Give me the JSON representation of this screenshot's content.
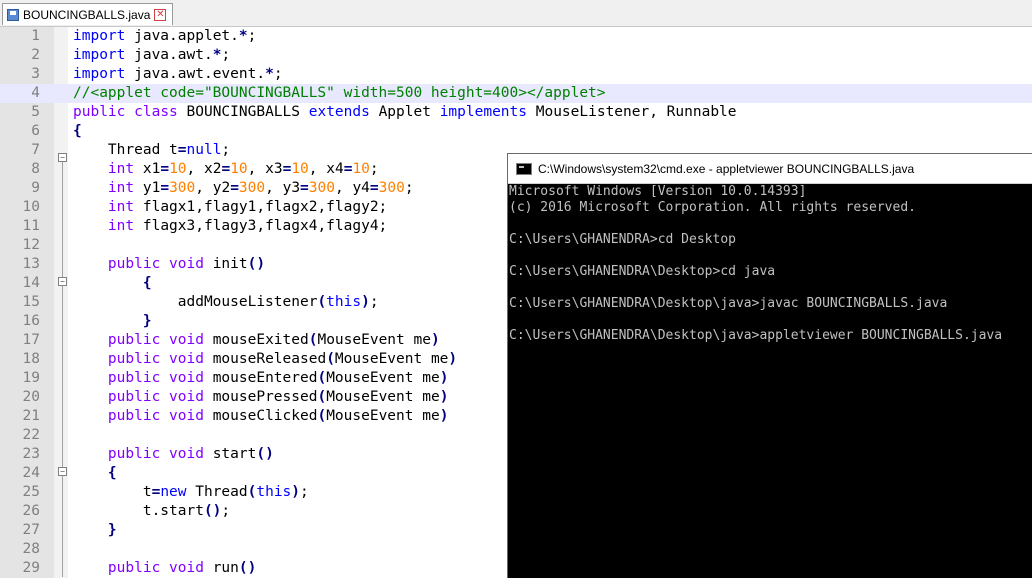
{
  "tab": {
    "label": "BOUNCINGBALLS.java"
  },
  "editor": {
    "highlighted_line": 4,
    "lines": [
      {
        "n": "1"
      },
      {
        "n": "2"
      },
      {
        "n": "3"
      },
      {
        "n": "4"
      },
      {
        "n": "5"
      },
      {
        "n": "6"
      },
      {
        "n": "7"
      },
      {
        "n": "8"
      },
      {
        "n": "9"
      },
      {
        "n": "10"
      },
      {
        "n": "11"
      },
      {
        "n": "12"
      },
      {
        "n": "13"
      },
      {
        "n": "14"
      },
      {
        "n": "15"
      },
      {
        "n": "16"
      },
      {
        "n": "17"
      },
      {
        "n": "18"
      },
      {
        "n": "19"
      },
      {
        "n": "20"
      },
      {
        "n": "21"
      },
      {
        "n": "22"
      },
      {
        "n": "23"
      },
      {
        "n": "24"
      },
      {
        "n": "25"
      },
      {
        "n": "26"
      },
      {
        "n": "27"
      },
      {
        "n": "28"
      },
      {
        "n": "29"
      }
    ],
    "code": [
      [
        [
          "kb",
          "import"
        ],
        [
          "pl",
          " java.applet."
        ],
        [
          "op",
          "*"
        ],
        [
          "pl",
          ";"
        ]
      ],
      [
        [
          "kb",
          "import"
        ],
        [
          "pl",
          " java.awt."
        ],
        [
          "op",
          "*"
        ],
        [
          "pl",
          ";"
        ]
      ],
      [
        [
          "kb",
          "import"
        ],
        [
          "pl",
          " java.awt.event."
        ],
        [
          "op",
          "*"
        ],
        [
          "pl",
          ";"
        ]
      ],
      [
        [
          "cm",
          "//<applet code=\"BOUNCINGBALLS\" width=500 height=400></applet>"
        ]
      ],
      [
        [
          "kw",
          "public"
        ],
        [
          "pl",
          " "
        ],
        [
          "kw",
          "class"
        ],
        [
          "pl",
          " BOUNCINGBALLS "
        ],
        [
          "kb",
          "extends"
        ],
        [
          "pl",
          " Applet "
        ],
        [
          "kb",
          "implements"
        ],
        [
          "pl",
          " MouseListener, Runnable"
        ]
      ],
      [
        [
          "op",
          "{"
        ]
      ],
      [
        [
          "pl",
          "    Thread t"
        ],
        [
          "op",
          "="
        ],
        [
          "kb",
          "null"
        ],
        [
          "pl",
          ";"
        ]
      ],
      [
        [
          "pl",
          "    "
        ],
        [
          "kw",
          "int"
        ],
        [
          "pl",
          " x1"
        ],
        [
          "op",
          "="
        ],
        [
          "num",
          "10"
        ],
        [
          "pl",
          ", x2"
        ],
        [
          "op",
          "="
        ],
        [
          "num",
          "10"
        ],
        [
          "pl",
          ", x3"
        ],
        [
          "op",
          "="
        ],
        [
          "num",
          "10"
        ],
        [
          "pl",
          ", x4"
        ],
        [
          "op",
          "="
        ],
        [
          "num",
          "10"
        ],
        [
          "pl",
          ";"
        ]
      ],
      [
        [
          "pl",
          "    "
        ],
        [
          "kw",
          "int"
        ],
        [
          "pl",
          " y1"
        ],
        [
          "op",
          "="
        ],
        [
          "num",
          "300"
        ],
        [
          "pl",
          ", y2"
        ],
        [
          "op",
          "="
        ],
        [
          "num",
          "300"
        ],
        [
          "pl",
          ", y3"
        ],
        [
          "op",
          "="
        ],
        [
          "num",
          "300"
        ],
        [
          "pl",
          ", y4"
        ],
        [
          "op",
          "="
        ],
        [
          "num",
          "300"
        ],
        [
          "pl",
          ";"
        ]
      ],
      [
        [
          "pl",
          "    "
        ],
        [
          "kw",
          "int"
        ],
        [
          "pl",
          " flagx1,flagy1,flagx2,flagy2;"
        ]
      ],
      [
        [
          "pl",
          "    "
        ],
        [
          "kw",
          "int"
        ],
        [
          "pl",
          " flagx3,flagy3,flagx4,flagy4;"
        ]
      ],
      [],
      [
        [
          "pl",
          "    "
        ],
        [
          "kw",
          "public"
        ],
        [
          "pl",
          " "
        ],
        [
          "kw",
          "void"
        ],
        [
          "pl",
          " init"
        ],
        [
          "op",
          "()"
        ]
      ],
      [
        [
          "pl",
          "        "
        ],
        [
          "op",
          "{"
        ]
      ],
      [
        [
          "pl",
          "            addMouseListener"
        ],
        [
          "op",
          "("
        ],
        [
          "kb",
          "this"
        ],
        [
          "op",
          ")"
        ],
        [
          "pl",
          ";"
        ]
      ],
      [
        [
          "pl",
          "        "
        ],
        [
          "op",
          "}"
        ]
      ],
      [
        [
          "pl",
          "    "
        ],
        [
          "kw",
          "public"
        ],
        [
          "pl",
          " "
        ],
        [
          "kw",
          "void"
        ],
        [
          "pl",
          " mouseExited"
        ],
        [
          "op",
          "("
        ],
        [
          "pl",
          "MouseEvent me"
        ],
        [
          "op",
          ")"
        ]
      ],
      [
        [
          "pl",
          "    "
        ],
        [
          "kw",
          "public"
        ],
        [
          "pl",
          " "
        ],
        [
          "kw",
          "void"
        ],
        [
          "pl",
          " mouseReleased"
        ],
        [
          "op",
          "("
        ],
        [
          "pl",
          "MouseEvent me"
        ],
        [
          "op",
          ")"
        ]
      ],
      [
        [
          "pl",
          "    "
        ],
        [
          "kw",
          "public"
        ],
        [
          "pl",
          " "
        ],
        [
          "kw",
          "void"
        ],
        [
          "pl",
          " mouseEntered"
        ],
        [
          "op",
          "("
        ],
        [
          "pl",
          "MouseEvent me"
        ],
        [
          "op",
          ")"
        ]
      ],
      [
        [
          "pl",
          "    "
        ],
        [
          "kw",
          "public"
        ],
        [
          "pl",
          " "
        ],
        [
          "kw",
          "void"
        ],
        [
          "pl",
          " mousePressed"
        ],
        [
          "op",
          "("
        ],
        [
          "pl",
          "MouseEvent me"
        ],
        [
          "op",
          ")"
        ]
      ],
      [
        [
          "pl",
          "    "
        ],
        [
          "kw",
          "public"
        ],
        [
          "pl",
          " "
        ],
        [
          "kw",
          "void"
        ],
        [
          "pl",
          " mouseClicked"
        ],
        [
          "op",
          "("
        ],
        [
          "pl",
          "MouseEvent me"
        ],
        [
          "op",
          ")"
        ]
      ],
      [],
      [
        [
          "pl",
          "    "
        ],
        [
          "kw",
          "public"
        ],
        [
          "pl",
          " "
        ],
        [
          "kw",
          "void"
        ],
        [
          "pl",
          " start"
        ],
        [
          "op",
          "()"
        ]
      ],
      [
        [
          "pl",
          "    "
        ],
        [
          "op",
          "{"
        ]
      ],
      [
        [
          "pl",
          "        t"
        ],
        [
          "op",
          "="
        ],
        [
          "kb",
          "new"
        ],
        [
          "pl",
          " Thread"
        ],
        [
          "op",
          "("
        ],
        [
          "kb",
          "this"
        ],
        [
          "op",
          ")"
        ],
        [
          "pl",
          ";"
        ]
      ],
      [
        [
          "pl",
          "        t.start"
        ],
        [
          "op",
          "()"
        ],
        [
          "pl",
          ";"
        ]
      ],
      [
        [
          "pl",
          "    "
        ],
        [
          "op",
          "}"
        ]
      ],
      [],
      [
        [
          "pl",
          "    "
        ],
        [
          "kw",
          "public"
        ],
        [
          "pl",
          " "
        ],
        [
          "kw",
          "void"
        ],
        [
          "pl",
          " run"
        ],
        [
          "op",
          "()"
        ]
      ]
    ]
  },
  "cmd": {
    "title": "C:\\Windows\\system32\\cmd.exe - appletviewer  BOUNCINGBALLS.java",
    "lines": [
      "Microsoft Windows [Version 10.0.14393]",
      "(c) 2016 Microsoft Corporation. All rights reserved.",
      "",
      "C:\\Users\\GHANENDRA>cd Desktop",
      "",
      "C:\\Users\\GHANENDRA\\Desktop>cd java",
      "",
      "C:\\Users\\GHANENDRA\\Desktop\\java>javac BOUNCINGBALLS.java",
      "",
      "C:\\Users\\GHANENDRA\\Desktop\\java>appletviewer BOUNCINGBALLS.java"
    ]
  }
}
